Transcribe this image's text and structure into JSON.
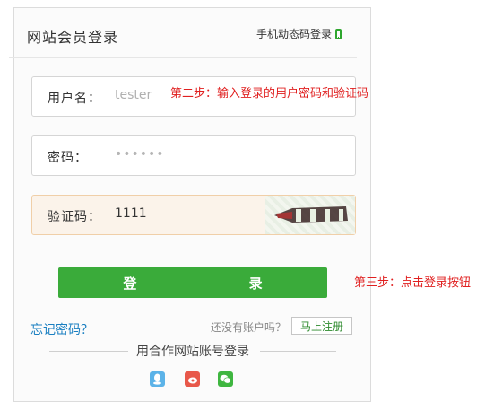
{
  "header": {
    "title": "网站会员登录",
    "mobile_login": "手机动态码登录"
  },
  "form": {
    "username": {
      "label": "用户名：",
      "value": "tester"
    },
    "password": {
      "label": "密码：",
      "value": "••••••"
    },
    "captcha": {
      "label": "验证码：",
      "value": "1111"
    }
  },
  "annotations": {
    "step2": "第二步：输入登录的用户密码和验证码",
    "step3": "第三步：点击登录按钮"
  },
  "login_button": "登 录",
  "links": {
    "forgot_password": "忘记密码？",
    "no_account": "还没有账户吗？",
    "register": "马上注册"
  },
  "partner": {
    "title": "用合作网站账号登录",
    "icons": [
      "qq-icon",
      "weibo-icon",
      "wechat-icon"
    ]
  },
  "colors": {
    "accent_green": "#3aab3a",
    "link_blue": "#1a7fc1",
    "annotation_red": "#e02020"
  }
}
